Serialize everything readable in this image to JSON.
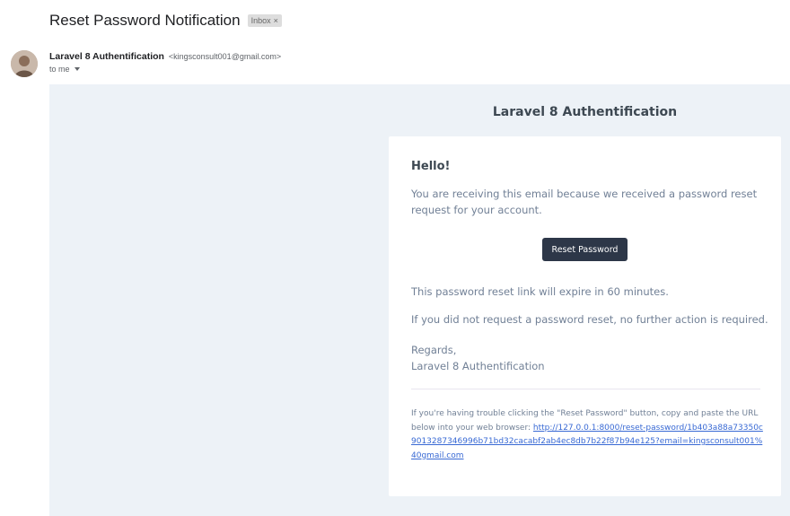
{
  "email": {
    "subject": "Reset Password Notification",
    "label": "Inbox",
    "label_close": "×",
    "sender_name": "Laravel 8 Authentification",
    "sender_email": "<kingsconsult001@gmail.com>",
    "to_line": "to me"
  },
  "body": {
    "app_name": "Laravel 8 Authentification",
    "greeting": "Hello!",
    "intro": "You are receiving this email because we received a password reset request for your account.",
    "button_label": "Reset Password",
    "expire_note": "This password reset link will expire in 60 minutes.",
    "no_action_note": "If you did not request a password reset, no further action is required.",
    "regards": "Regards,",
    "signature": "Laravel 8 Authentification",
    "trouble_text": "If you're having trouble clicking the \"Reset Password\" button, copy and paste the URL below into your web browser:",
    "reset_url": "http://127.0.0.1:8000/reset-password/1b403a88a73350c9013287346996b71bd32cacabf2ab4ec8db7b22f87b94e125?email=kingsconsult001%40gmail.com"
  },
  "colors": {
    "background": "#edf2f7",
    "button": "#2d3748",
    "link": "#3869d4"
  }
}
